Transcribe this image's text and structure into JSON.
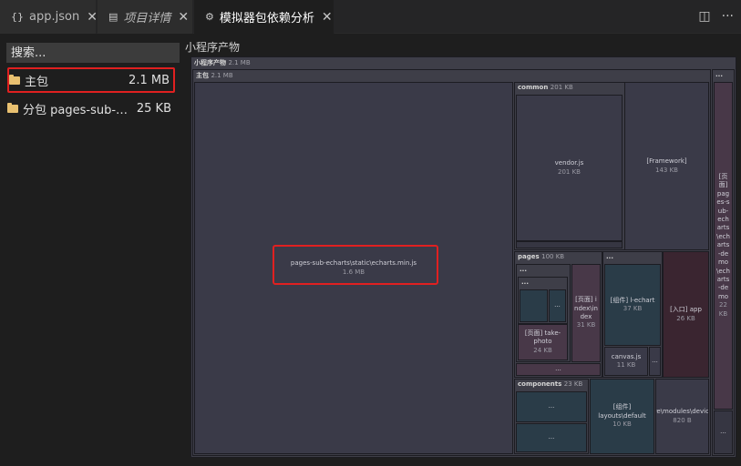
{
  "tabs": [
    {
      "icon": "{}",
      "label": "app.json",
      "italic": false,
      "active": false
    },
    {
      "icon": "▤",
      "label": "项目详情",
      "italic": true,
      "active": false
    },
    {
      "icon": "⚙",
      "label": "模拟器包依赖分析",
      "italic": false,
      "active": true
    }
  ],
  "tab_actions": {
    "split": "◫",
    "more": "···"
  },
  "sidebar": {
    "search_placeholder": "搜索...",
    "items": [
      {
        "name": "主包",
        "size": "2.1 MB"
      },
      {
        "name": "分包 pages-sub-echarts",
        "size": "25 KB"
      }
    ]
  },
  "treemap": {
    "title": "小程序产物",
    "root": {
      "name": "小程序产物",
      "size": "2.1 MB"
    },
    "main": {
      "name": "主包",
      "size": "2.1 MB"
    },
    "echarts": {
      "name": "pages-sub-echarts\\static\\echarts.min.js",
      "size": "1.6 MB"
    },
    "common": {
      "name": "common",
      "size": "201 KB"
    },
    "vendor": {
      "name": "vendor.js",
      "size": "201 KB"
    },
    "framework": {
      "name": "[Framework]",
      "size": "143 KB"
    },
    "pages": {
      "name": "pages",
      "size": "100 KB"
    },
    "take_photo": {
      "name": "[页面] take-photo",
      "size": "24 KB"
    },
    "index_page": {
      "name": "[页面] index\\index",
      "size": "31 KB"
    },
    "echart_comp": {
      "name": "[组件] l-echart",
      "size": "37 KB"
    },
    "canvas": {
      "name": "canvas.js",
      "size": "11 KB"
    },
    "entry_app": {
      "name": "[入口] app",
      "size": "26 KB"
    },
    "components": {
      "name": "components",
      "size": "23 KB"
    },
    "layouts_default": {
      "name": "[组件] layouts\\default",
      "size": "10 KB"
    },
    "store_device": {
      "name": "store\\modules\\device.js",
      "size": "820 B"
    },
    "sub_page": {
      "name": "[页面] pages-sub-echarts\\echarts-demo\\echarts-demo",
      "size": "22 KB"
    },
    "ellipsis": "..."
  }
}
